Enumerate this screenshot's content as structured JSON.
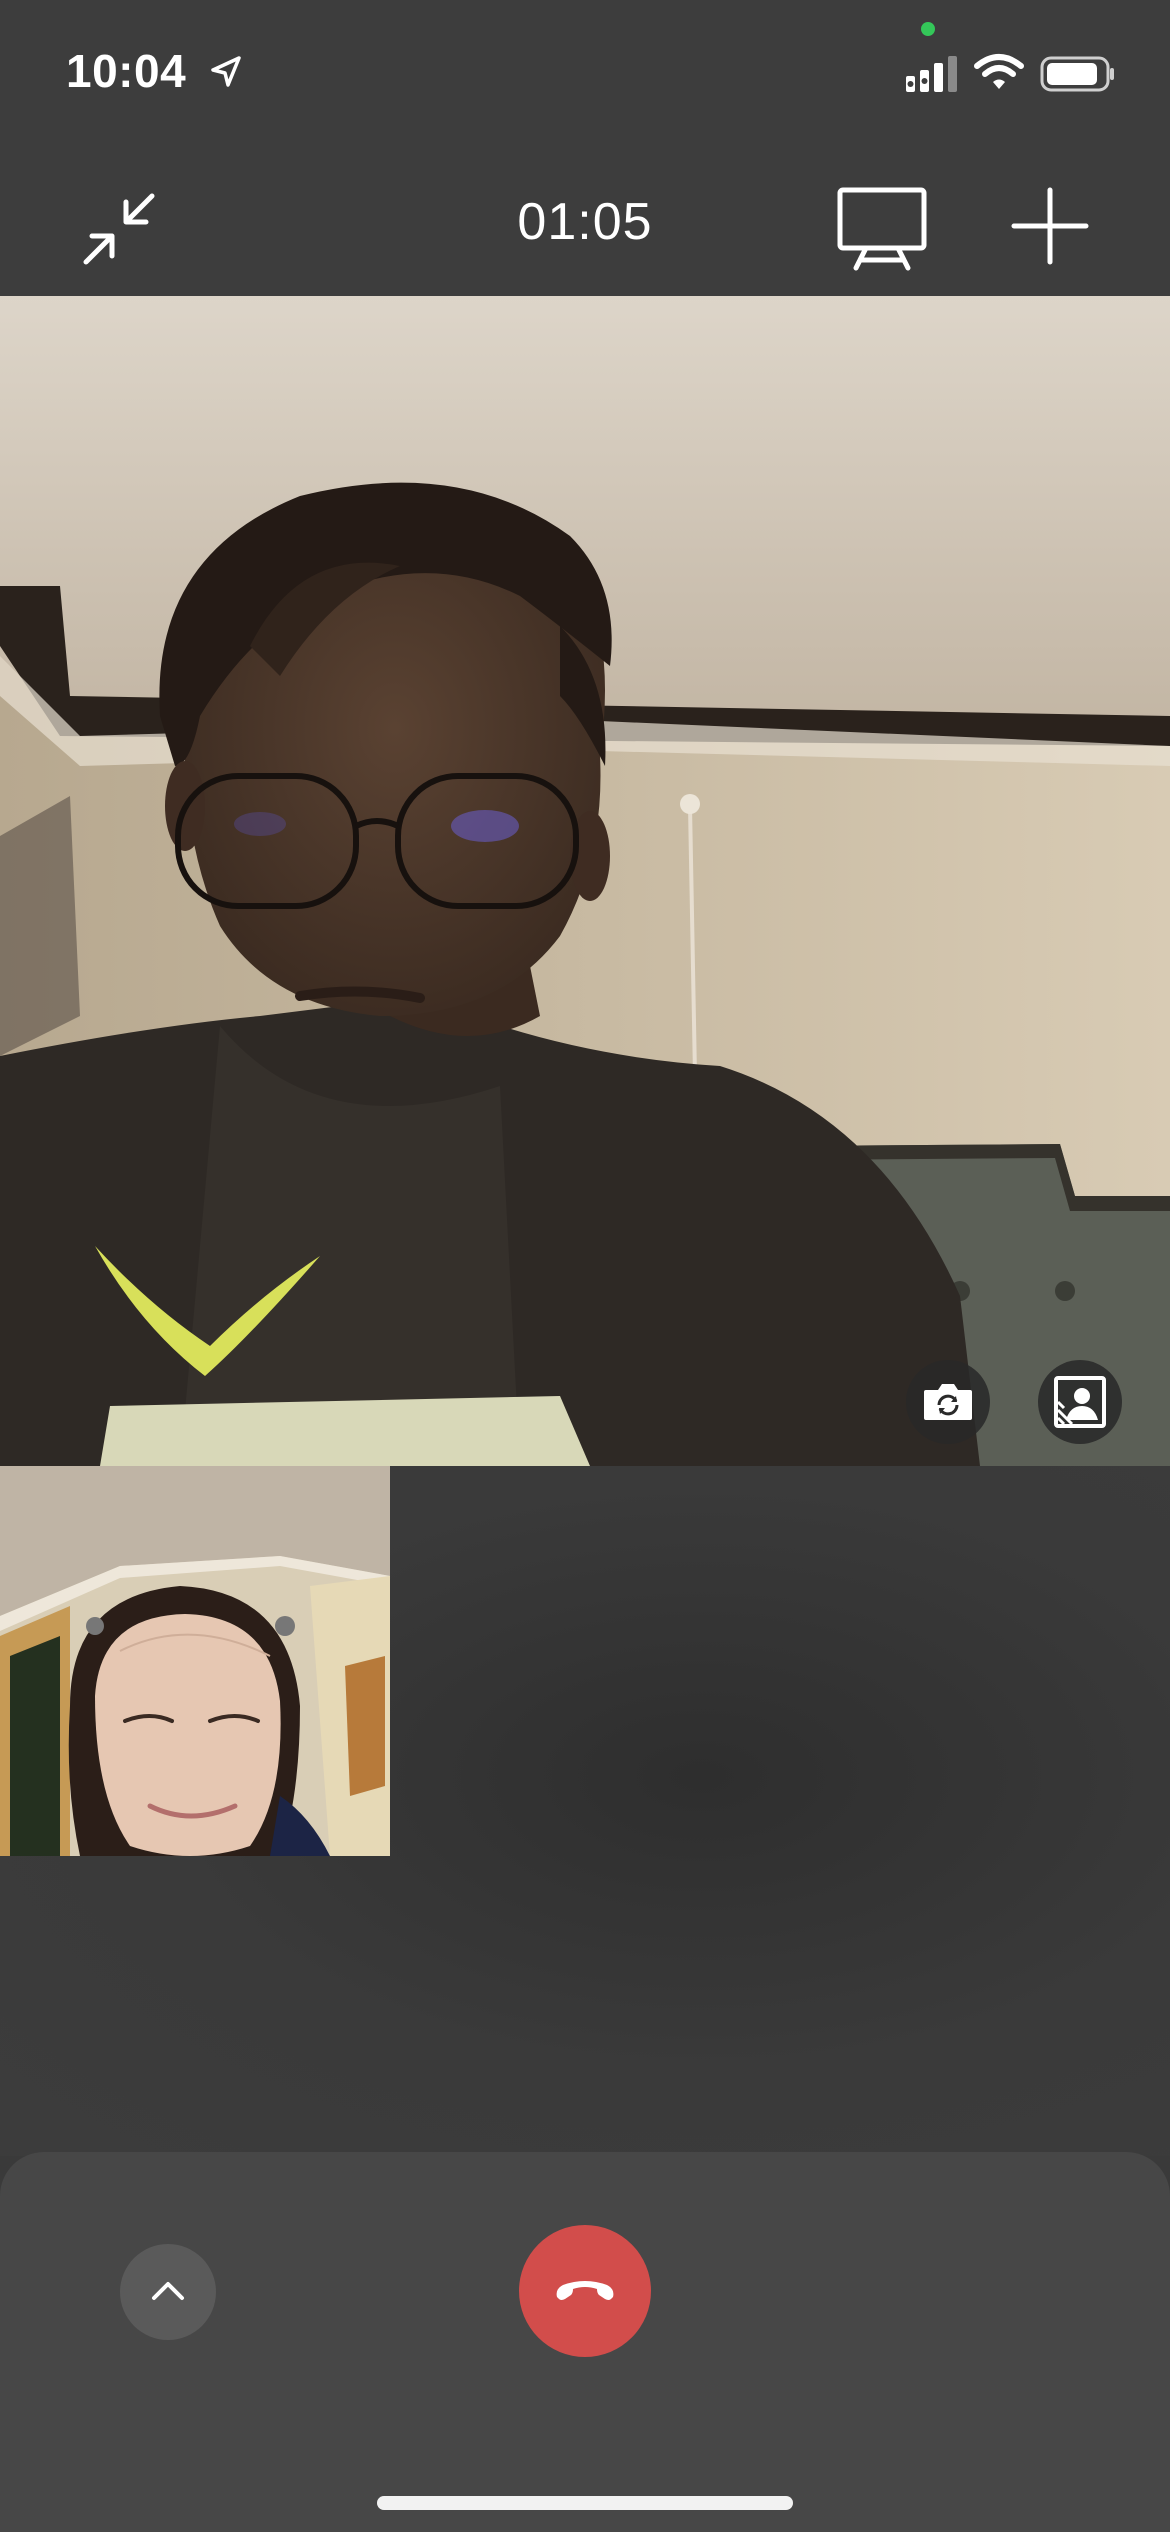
{
  "status_bar": {
    "time": "10:04",
    "icons": [
      "location-arrow-icon",
      "camera-in-use-dot",
      "cellular-signal-icon",
      "wifi-icon",
      "battery-icon"
    ]
  },
  "top_bar": {
    "call_timer": "01:05",
    "icons": [
      "minimize-arrows-icon",
      "screen-share-icon",
      "plus-icon"
    ]
  },
  "remote_video": {
    "controls": [
      "camera-flip-icon",
      "background-effect-icon"
    ]
  },
  "controls": {
    "icons": [
      "chevron-up-icon",
      "hang-up-phone-icon"
    ],
    "end_call_color": "#d24d4b"
  },
  "colors": {
    "background": "#3a3a3a",
    "sheet": "#474747",
    "accent_green": "#34c759"
  }
}
